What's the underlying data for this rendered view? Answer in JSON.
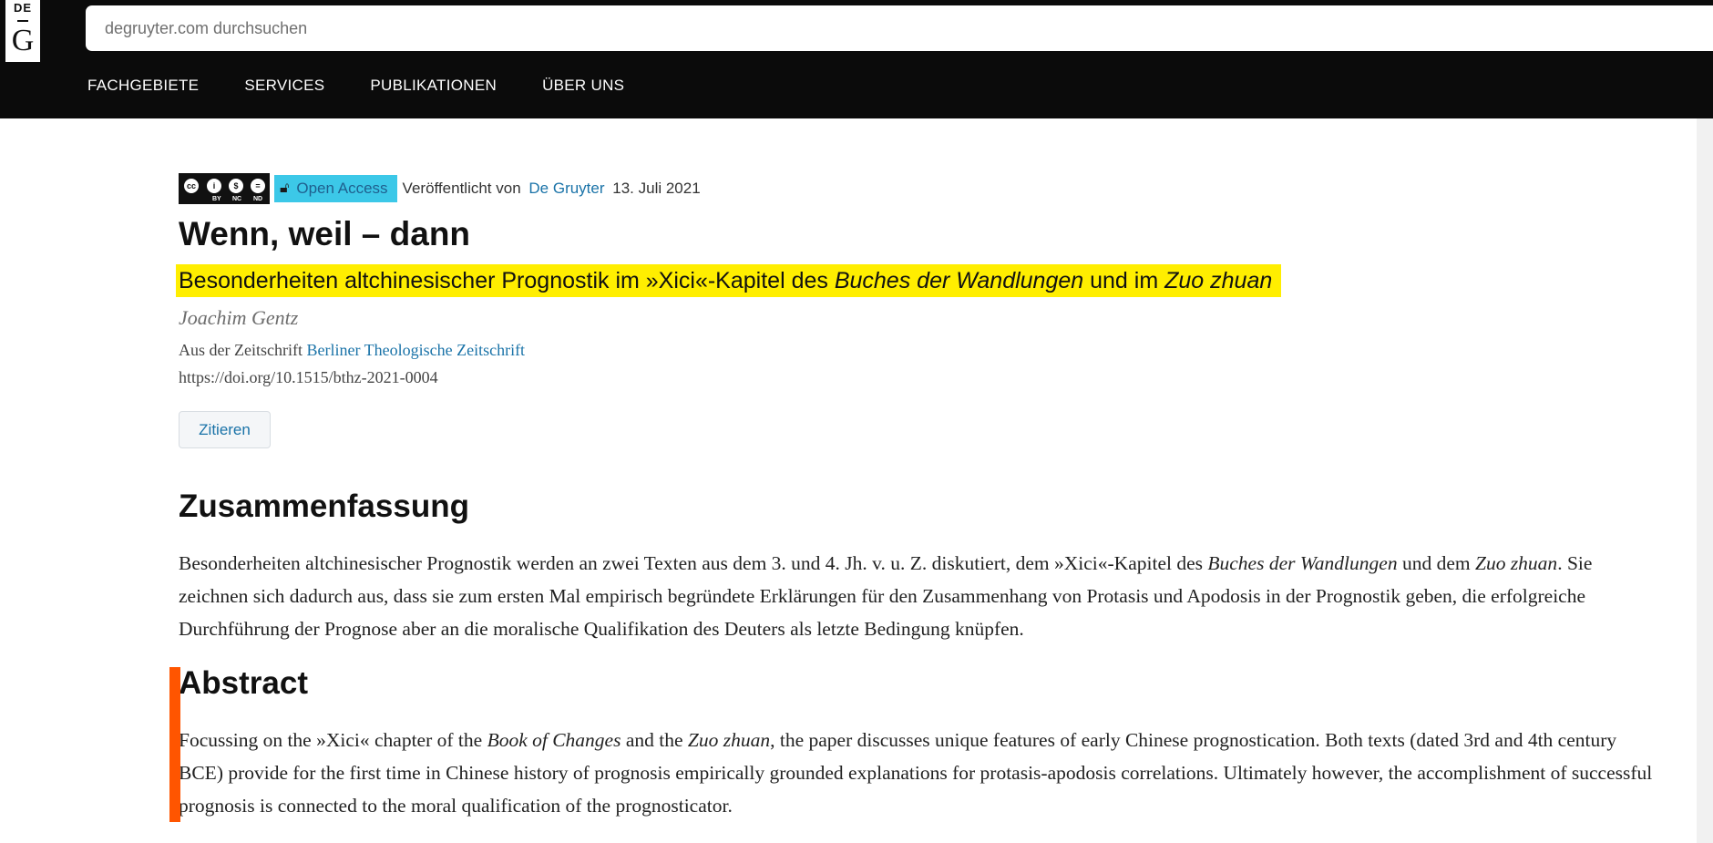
{
  "header": {
    "logo": {
      "top": "DE",
      "bottom": "G"
    },
    "search_placeholder": "degruyter.com durchsuchen",
    "nav": [
      {
        "label": "FACHGEBIETE"
      },
      {
        "label": "SERVICES"
      },
      {
        "label": "PUBLIKATIONEN"
      },
      {
        "label": "ÜBER UNS"
      }
    ]
  },
  "article": {
    "license": {
      "icon": "cc-by-nc-nd-badge",
      "labels": [
        "BY",
        "NC",
        "ND"
      ]
    },
    "open_access_label": "Open Access",
    "published_prefix": "Veröffentlicht von",
    "publisher": "De Gruyter",
    "date": "13. Juli 2021",
    "title": "Wenn, weil – dann",
    "subtitle": {
      "part1": "Besonderheiten altchinesischer Prognostik im »Xici«-Kapitel des ",
      "italic1": "Buches der Wandlungen",
      "part2": " und im ",
      "italic2": "Zuo zhuan"
    },
    "author": "Joachim Gentz",
    "journal_prefix": "Aus der Zeitschrift",
    "journal": "Berliner Theologische Zeitschrift",
    "doi": "https://doi.org/10.1515/bthz-2021-0004",
    "cite_label": "Zitieren"
  },
  "sections": {
    "zusammenfassung": {
      "heading": "Zusammenfassung",
      "t1": "Besonderheiten altchinesischer Prognostik werden an zwei Texten aus dem 3. und 4. Jh. v. u. Z. diskutiert, dem »Xici«-Kapitel des ",
      "i1": "Buches der Wandlungen",
      "t2": " und dem ",
      "i2": "Zuo zhuan",
      "t3": ". Sie zeichnen sich dadurch aus, dass sie zum ersten Mal empirisch begründete Erklärungen für den Zusammenhang von Protasis und Apodosis in der Prognostik geben, die erfolgreiche Durchführung der Prognose aber an die moralische Qualifikation des Deuters als letzte Bedingung knüpfen."
    },
    "abstract": {
      "heading": "Abstract",
      "t1": "Focussing on the »Xici« chapter of the ",
      "i1": "Book of Changes",
      "t2": " and the ",
      "i2": "Zuo zhuan",
      "t3": ", the paper discusses unique features of early Chinese prognostication. Both texts (dated 3rd and 4th century BCE) provide for the first time in Chinese history of prognosis empirically grounded explanations for protasis-apodosis correlations. Ultimately however, the accomplishment of successful prognosis is connected to the moral qualification of the prognosticator."
    }
  },
  "colors": {
    "header_bg": "#0b0b0b",
    "link": "#1a73a8",
    "open_access_bg": "#3cc8e8",
    "subtitle_highlight": "#ffee00",
    "highlight_bar": "#ff5500"
  }
}
